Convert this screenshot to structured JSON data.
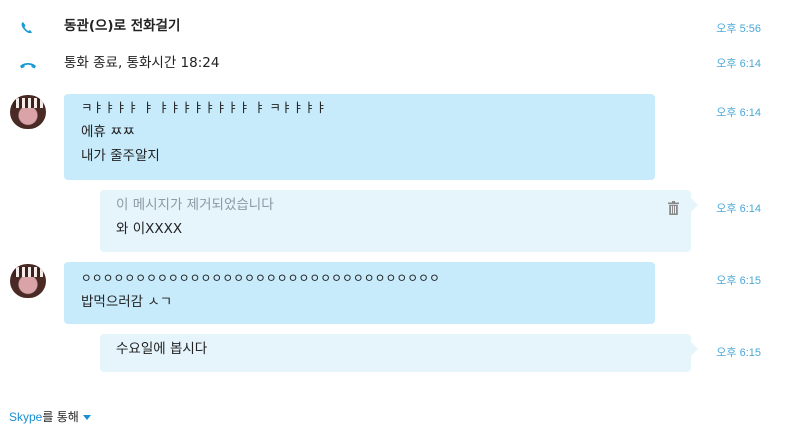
{
  "colors": {
    "accent": "#1a8fd0",
    "bubble_incoming": "#c7ebfb",
    "bubble_outgoing": "#e6f4fc",
    "timestamp": "#4ba8d6"
  },
  "events": [
    {
      "icon": "phone-icon",
      "bold_text": "동관(으)로 전화걸기",
      "text": "",
      "time": "오후 5:56"
    },
    {
      "icon": "hang-up-icon",
      "bold_text": "",
      "text": "통화 종료, 통화시간 18:24",
      "time": "오후 6:14"
    }
  ],
  "messages": [
    {
      "direction": "incoming",
      "lines": [
        "ㅋㅑㅑㅑㅑ ㅑ ㅑㅑㅑㅑㅑㅑㅑㅑ ㅑ ㅋㅑㅑㅑㅑ",
        "에휴 ㅉㅉ",
        "내가 줄주알지"
      ],
      "time": "오후 6:14"
    },
    {
      "direction": "outgoing",
      "removed_notice": "이 메시지가 제거되었습니다",
      "lines": [
        "와 이XXXX"
      ],
      "time": "오후 6:14",
      "icon": "trash-icon"
    },
    {
      "direction": "incoming",
      "lines": [
        "ㅇㅇㅇㅇㅇㅇㅇㅇㅇㅇㅇㅇㅇㅇㅇㅇㅇㅇㅇㅇㅇㅇㅇㅇㅇㅇㅇㅇㅇㅇㅇㅇㅇ",
        "밥먹으러감 ㅅㄱ"
      ],
      "time": "오후 6:15"
    },
    {
      "direction": "outgoing",
      "lines": [
        "수요일에 봅시다"
      ],
      "time": "오후 6:15"
    }
  ],
  "footer": {
    "link": "Skype",
    "suffix": "를 통해"
  }
}
